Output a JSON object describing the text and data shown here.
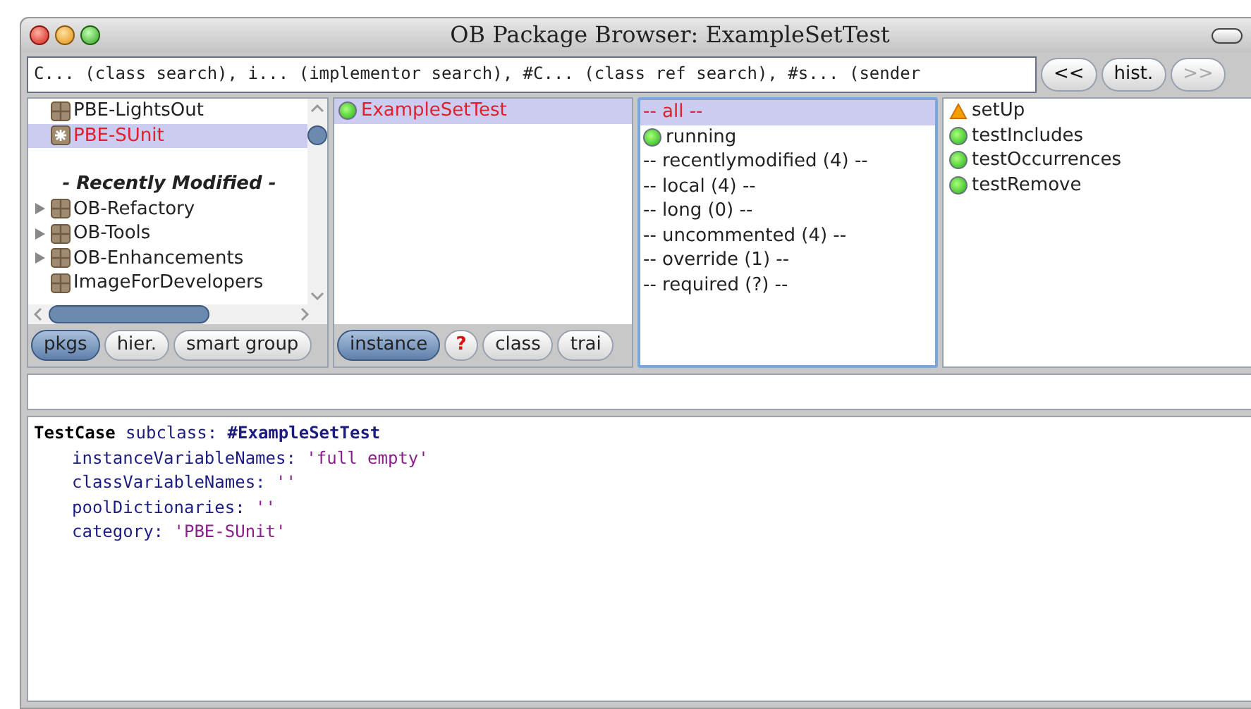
{
  "window": {
    "title": "OB Package Browser: ExampleSetTest"
  },
  "search": {
    "value": "C... (class search), i... (implementor search), #C... (class ref search), #s... (sender"
  },
  "nav_buttons": [
    {
      "label": "<<",
      "disabled": false
    },
    {
      "label": "hist.",
      "disabled": false
    },
    {
      "label": ">>",
      "disabled": true
    }
  ],
  "packages": [
    {
      "label": "PBE-LightsOut",
      "kind": "package",
      "expandable": false,
      "selected": false
    },
    {
      "label": "PBE-SUnit",
      "kind": "test-package",
      "expandable": false,
      "selected": true
    },
    {
      "label": "- Recently Modified -",
      "kind": "heading",
      "selected": false
    },
    {
      "label": "OB-Refactory",
      "kind": "package",
      "expandable": true,
      "selected": false
    },
    {
      "label": "OB-Tools",
      "kind": "package",
      "expandable": true,
      "selected": false
    },
    {
      "label": "OB-Enhancements",
      "kind": "package",
      "expandable": true,
      "selected": false
    },
    {
      "label": "ImageForDevelopers",
      "kind": "package",
      "expandable": false,
      "selected": false
    }
  ],
  "package_buttons": [
    {
      "label": "pkgs",
      "selected": true
    },
    {
      "label": "hier.",
      "selected": false
    },
    {
      "label": "smart group",
      "selected": false
    }
  ],
  "classes": [
    {
      "label": "ExampleSetTest",
      "kind": "pass",
      "selected": true
    }
  ],
  "class_buttons": [
    {
      "label": "instance",
      "kind": "toggle",
      "selected": true
    },
    {
      "label": "?",
      "kind": "help"
    },
    {
      "label": "class",
      "kind": "toggle",
      "selected": false
    },
    {
      "label": "trai",
      "kind": "toggle",
      "selected": false
    }
  ],
  "categories": [
    {
      "label": "-- all --",
      "kind": "plain",
      "selected": true
    },
    {
      "label": "running",
      "kind": "pass",
      "selected": false
    },
    {
      "label": "-- recentlymodified (4) --",
      "kind": "plain",
      "selected": false
    },
    {
      "label": "-- local (4) --",
      "kind": "plain",
      "selected": false
    },
    {
      "label": "-- long (0) --",
      "kind": "plain",
      "selected": false
    },
    {
      "label": "-- uncommented (4) --",
      "kind": "plain",
      "selected": false
    },
    {
      "label": "-- override (1) --",
      "kind": "plain",
      "selected": false
    },
    {
      "label": "-- required (?) --",
      "kind": "plain",
      "selected": false
    }
  ],
  "methods": [
    {
      "label": "setUp",
      "kind": "warning",
      "selected": false
    },
    {
      "label": "testIncludes",
      "kind": "pass",
      "selected": false
    },
    {
      "label": "testOccurrences",
      "kind": "pass",
      "selected": false
    },
    {
      "label": "testRemove",
      "kind": "pass",
      "selected": false
    }
  ],
  "code": {
    "lines": [
      {
        "indented": false,
        "tokens": [
          {
            "kind": "class",
            "text": "TestCase"
          },
          {
            "kind": "keyword",
            "text": "subclass:"
          },
          {
            "kind": "symbol",
            "text": "#ExampleSetTest"
          }
        ]
      },
      {
        "indented": true,
        "tokens": [
          {
            "kind": "keyword",
            "text": "instanceVariableNames:"
          },
          {
            "kind": "string",
            "text": "'full empty'"
          }
        ]
      },
      {
        "indented": true,
        "tokens": [
          {
            "kind": "keyword",
            "text": "classVariableNames:"
          },
          {
            "kind": "string",
            "text": "''"
          }
        ]
      },
      {
        "indented": true,
        "tokens": [
          {
            "kind": "keyword",
            "text": "poolDictionaries:"
          },
          {
            "kind": "string",
            "text": "''"
          }
        ]
      },
      {
        "indented": true,
        "tokens": [
          {
            "kind": "keyword",
            "text": "category:"
          },
          {
            "kind": "string",
            "text": "'PBE-SUnit'"
          }
        ]
      }
    ]
  }
}
